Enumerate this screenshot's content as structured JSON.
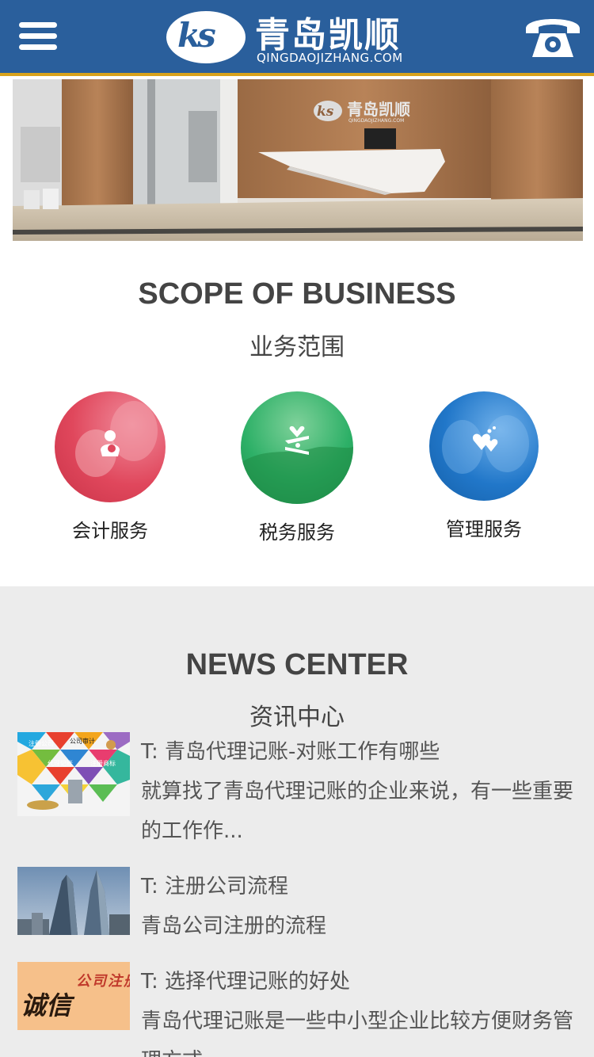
{
  "header": {
    "logo_mark": "ks",
    "logo_cn": "青岛凯顺",
    "logo_en": "QINGDAOJIZHANG.COM",
    "menu_icon": "hamburger-menu-icon",
    "phone_icon": "telephone-icon",
    "bg_color": "#2a5f9c",
    "accent_color": "#d8a21c"
  },
  "banner": {
    "wall_logo_cn": "青岛凯顺",
    "wall_logo_en": "QINGDAOJIZHANG.COM"
  },
  "scope": {
    "title": "SCOPE OF BUSINESS",
    "subtitle": "业务范围",
    "services": [
      {
        "label": "会计服务",
        "icon": "mother-baby-icon",
        "color": "#e0475c"
      },
      {
        "label": "税务服务",
        "icon": "hands-heart-icon",
        "color": "#2db067"
      },
      {
        "label": "管理服务",
        "icon": "hearts-icon",
        "color": "#2177c9"
      }
    ]
  },
  "news": {
    "title": "NEWS CENTER",
    "subtitle": "资讯中心",
    "items": [
      {
        "title": "T: 青岛代理记账-对账工作有哪些",
        "summary": "就算找了青岛代理记账的企业来说，有一些重要的工作作...",
        "thumb_tags": [
          "注册公司",
          "公司审计",
          "代理记账",
          "注册商标"
        ]
      },
      {
        "title": "T: 注册公司流程",
        "summary": "青岛公司注册的流程"
      },
      {
        "title": "T: 选择代理记账的好处",
        "summary": "青岛代理记账是一些中小型企业比较方便财务管理方式",
        "thumb_text_a": "公司注册",
        "thumb_text_b": "诚信"
      }
    ]
  }
}
